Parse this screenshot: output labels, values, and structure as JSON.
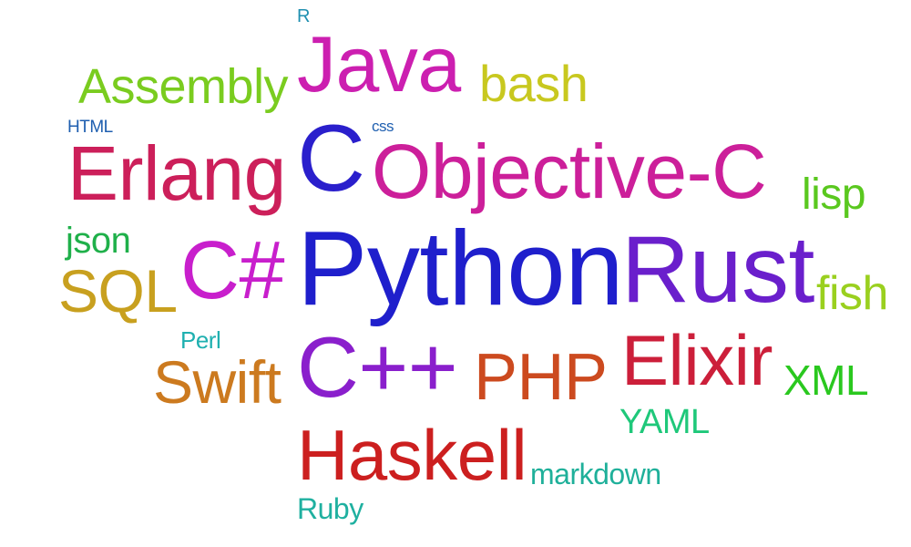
{
  "word_cloud": {
    "words": [
      {
        "text": "R",
        "color": "#1f8fb0"
      },
      {
        "text": "Java",
        "color": "#cc1fb0"
      },
      {
        "text": "Assembly",
        "color": "#7acc1f"
      },
      {
        "text": "bash",
        "color": "#c8c81f"
      },
      {
        "text": "HTML",
        "color": "#1f5fb0"
      },
      {
        "text": "css",
        "color": "#1f5fb0"
      },
      {
        "text": "C",
        "color": "#2a1fcc"
      },
      {
        "text": "Erlang",
        "color": "#cc1f5a"
      },
      {
        "text": "Objective-C",
        "color": "#cc1f9a"
      },
      {
        "text": "lisp",
        "color": "#5ac81f"
      },
      {
        "text": "json",
        "color": "#1fb04a"
      },
      {
        "text": "C#",
        "color": "#c81fcc"
      },
      {
        "text": "Python",
        "color": "#1f1fcc"
      },
      {
        "text": "Rust",
        "color": "#6a1fcc"
      },
      {
        "text": "SQL",
        "color": "#c8a01f"
      },
      {
        "text": "fish",
        "color": "#9ad01f"
      },
      {
        "text": "Perl",
        "color": "#1fb0b0"
      },
      {
        "text": "Swift",
        "color": "#cc7a1f"
      },
      {
        "text": "C++",
        "color": "#8a1fcc"
      },
      {
        "text": "PHP",
        "color": "#cc4a1f"
      },
      {
        "text": "Elixir",
        "color": "#cc1f3a"
      },
      {
        "text": "XML",
        "color": "#2ac81f"
      },
      {
        "text": "YAML",
        "color": "#1fc87a"
      },
      {
        "text": "Haskell",
        "color": "#cc1f1f"
      },
      {
        "text": "markdown",
        "color": "#1fb09a"
      },
      {
        "text": "Ruby",
        "color": "#1fb0a0"
      }
    ]
  }
}
